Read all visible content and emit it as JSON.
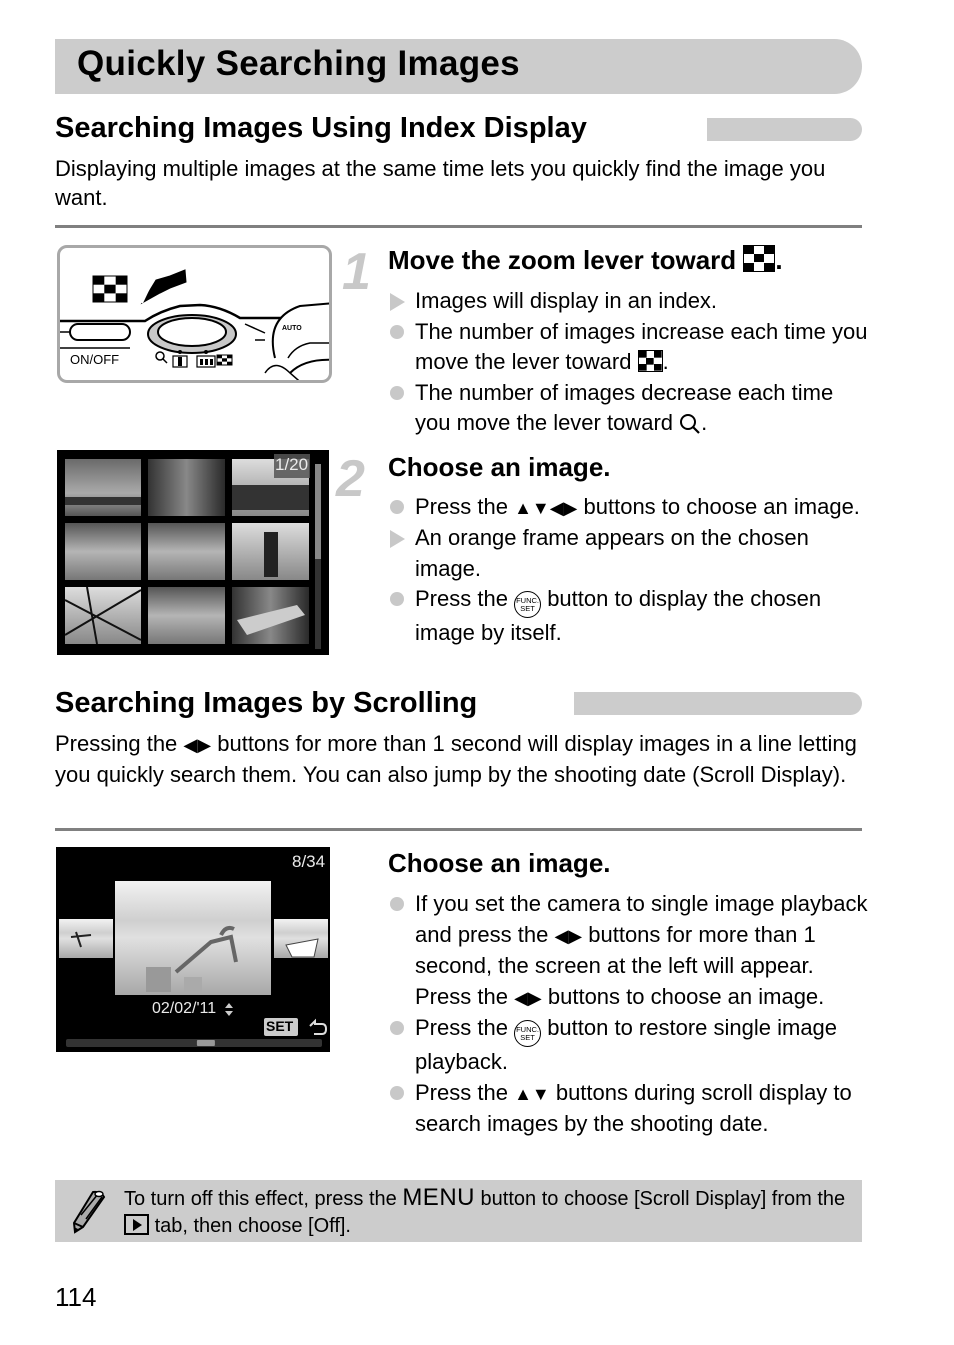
{
  "page": {
    "title": "Quickly Searching Images",
    "page_number": "114"
  },
  "section_index": {
    "heading": "Searching Images Using Index Display",
    "intro": "Displaying multiple images at the same time lets you quickly find the image you want.",
    "illustration": {
      "power_label": "ON/OFF"
    },
    "steps": [
      {
        "number": "1",
        "heading_prefix": "Move the zoom lever toward",
        "heading_suffix": ".",
        "items": [
          {
            "type": "result",
            "text": "Images will display in an index."
          },
          {
            "type": "note",
            "text_prefix": "The number of images increase each time you move the lever toward",
            "text_suffix": "."
          },
          {
            "type": "note",
            "text_prefix": "The number of images decrease each time you move the lever toward",
            "text_suffix": "."
          }
        ]
      },
      {
        "number": "2",
        "heading": "Choose an image.",
        "items": [
          {
            "type": "note",
            "text_prefix": "Press the",
            "text_suffix": "buttons to choose an image."
          },
          {
            "type": "result",
            "text": "An orange frame appears on the chosen image."
          },
          {
            "type": "note",
            "text_prefix": "Press the",
            "text_suffix": "button to display the chosen image by itself."
          }
        ]
      }
    ],
    "index_screen": {
      "counter": "1/20",
      "thumbnail_count": 9
    }
  },
  "section_scroll": {
    "heading": "Searching Images by Scrolling",
    "intro_prefix": "Pressing the",
    "intro_suffix": "buttons for more than 1 second will display images in a line letting you quickly search them. You can also jump by the shooting date (Scroll Display).",
    "step": {
      "heading": "Choose an image.",
      "items": [
        {
          "type": "note",
          "text_a": "If you set the camera to single image playback and press the",
          "text_b": "buttons for more than 1 second, the screen at the left will appear. Press the",
          "text_c": "buttons to choose an image."
        },
        {
          "type": "note",
          "text_prefix": "Press the",
          "text_suffix": "button to restore single image playback."
        },
        {
          "type": "note",
          "text_prefix": "Press the",
          "text_suffix": "buttons during scroll display to search images by the shooting date."
        }
      ]
    },
    "scroll_screen": {
      "counter": "8/34",
      "date": "02/02/'11",
      "set_label": "SET",
      "scroll_position": 0.55
    }
  },
  "note": {
    "text_a": "To turn off this effect, press the",
    "menu_label": "MENU",
    "text_b": "button to choose [Scroll Display] from the",
    "text_c": "tab, then choose [Off]."
  },
  "icons": {
    "func_set_top": "FUNC.",
    "func_set_bottom": "SET",
    "arrows_all": "▲▼◀▶",
    "arrows_lr": "◀▶",
    "arrows_ud": "▲▼"
  },
  "colors": {
    "accent_gray": "#cccccc",
    "rule_gray": "#808080",
    "bullet_gray": "#c8c8c8"
  }
}
